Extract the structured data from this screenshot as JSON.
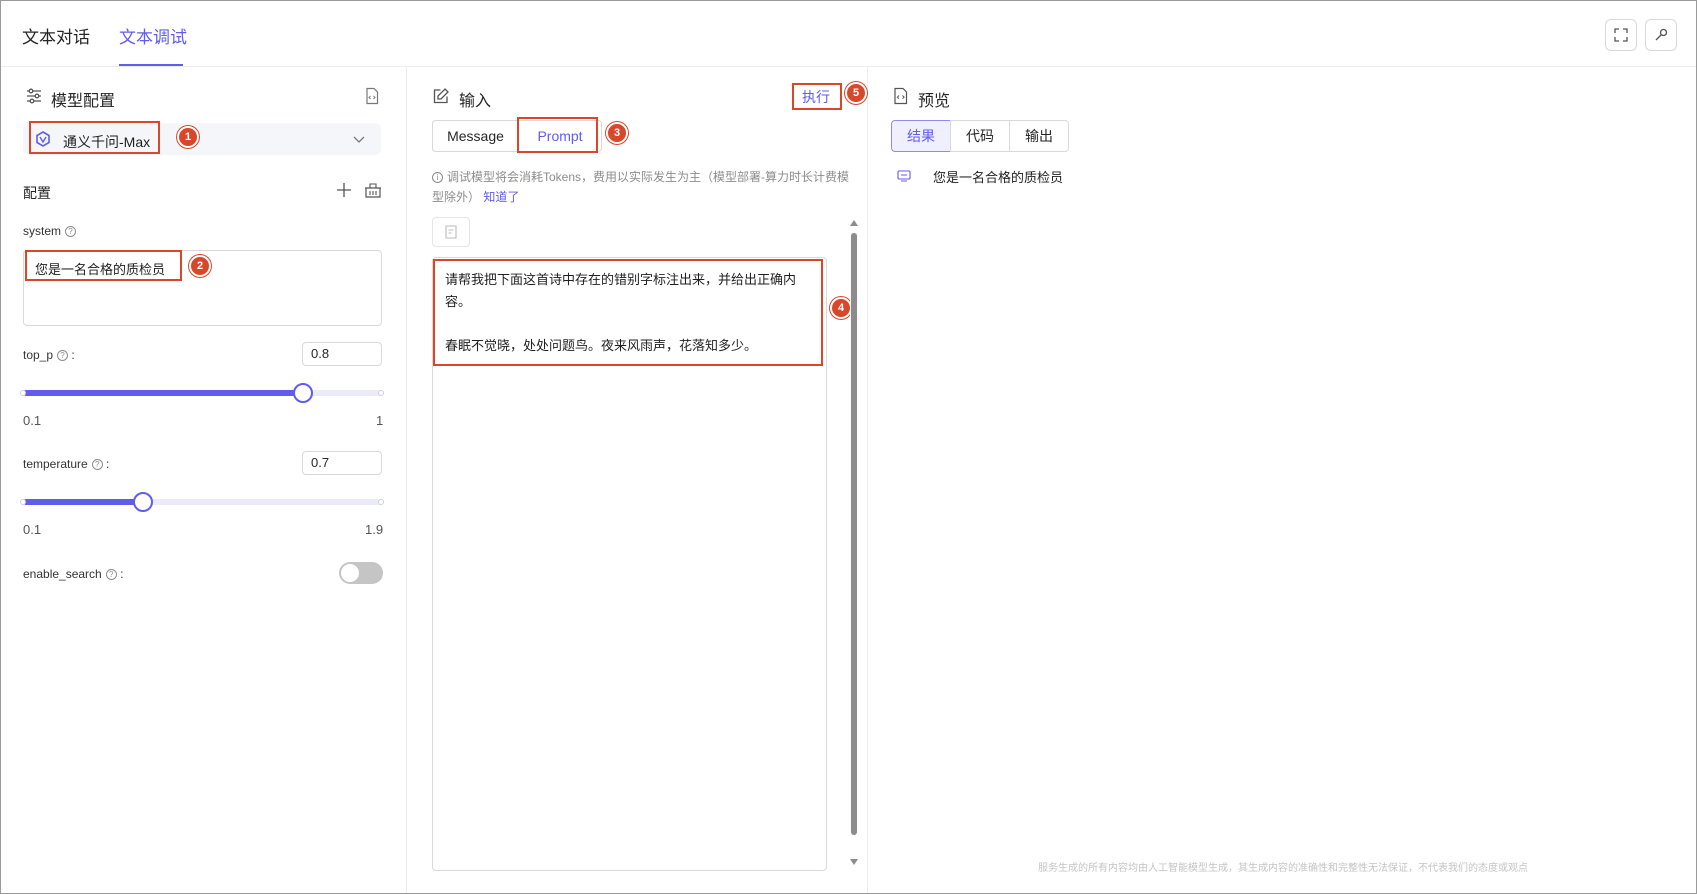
{
  "tabs": {
    "chat": "文本对话",
    "debug": "文本调试"
  },
  "config": {
    "title": "模型配置",
    "model_name": "通义千问-Max",
    "section_label": "配置",
    "system_label": "system",
    "system_value": "您是一名合格的质检员",
    "top_p_label": "top_p",
    "top_p_value": "0.8",
    "top_p_min": "0.1",
    "top_p_max": "1",
    "temperature_label": "temperature",
    "temperature_value": "0.7",
    "temperature_min": "0.1",
    "temperature_max": "1.9",
    "enable_search_label": "enable_search",
    "enable_search_on": false,
    "colon": ":"
  },
  "input": {
    "title": "输入",
    "run_label": "执行",
    "mode_message": "Message",
    "mode_prompt": "Prompt",
    "notice_text": "调试模型将会消耗Tokens，费用以实际发生为主（模型部署-算力时长计费模型除外）",
    "notice_link": "知道了",
    "prompt_text": "请帮我把下面这首诗中存在的错别字标注出来，并给出正确内容。\n\n春眠不觉晓，处处问题鸟。夜来风雨声，花落知多少。"
  },
  "preview": {
    "title": "预览",
    "tab_result": "结果",
    "tab_code": "代码",
    "tab_output": "输出",
    "result_text": "您是一名合格的质检员",
    "footer": "服务生成的所有内容均由人工智能模型生成，其生成内容的准确性和完整性无法保证，不代表我们的态度或观点"
  },
  "annotations": [
    "1",
    "2",
    "3",
    "4",
    "5"
  ],
  "colors": {
    "accent": "#615ced",
    "annotation": "#d9472b"
  }
}
